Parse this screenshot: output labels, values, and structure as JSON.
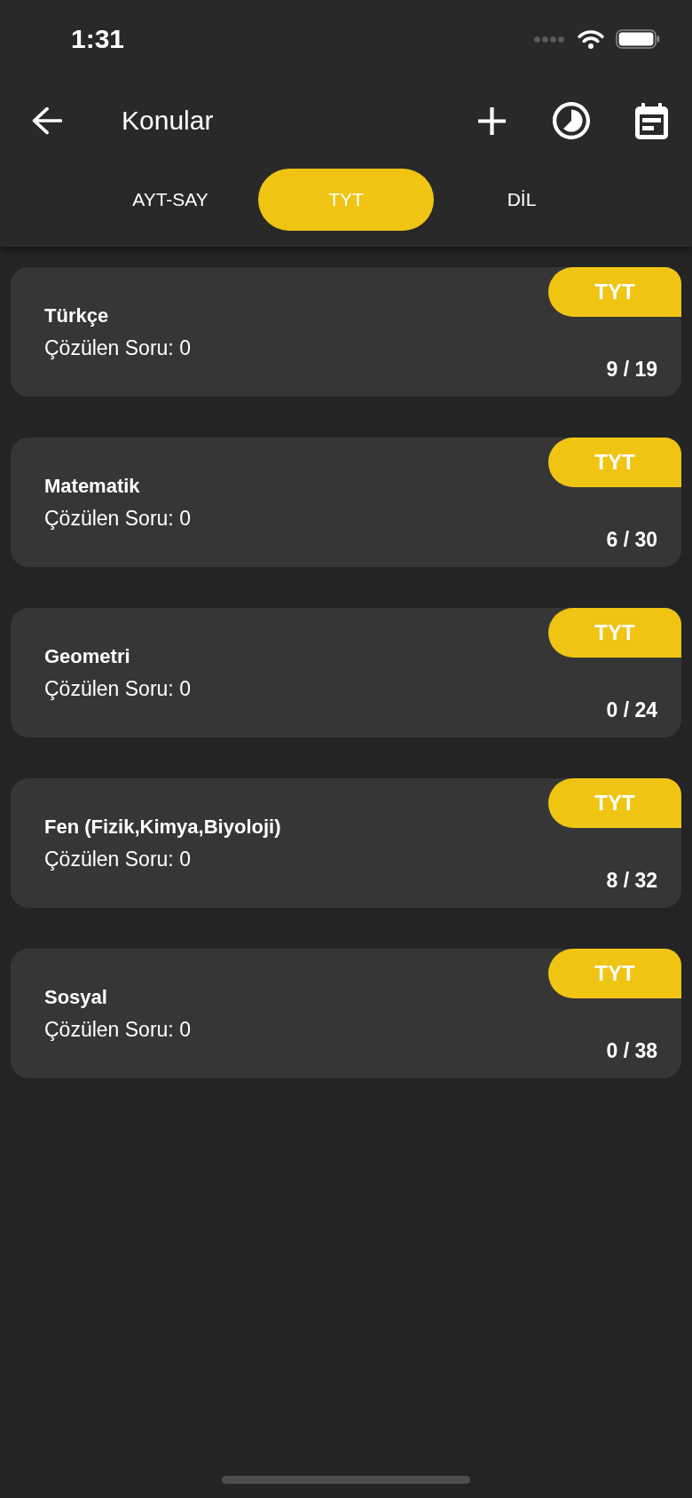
{
  "status_bar": {
    "time": "1:31"
  },
  "header": {
    "title": "Konular"
  },
  "tabs": [
    {
      "label": "AYT-SAY",
      "selected": false
    },
    {
      "label": "TYT",
      "selected": true
    },
    {
      "label": "DİL",
      "selected": false
    }
  ],
  "subjects": [
    {
      "name": "Türkçe",
      "solved": "Çözülen Soru: 0",
      "badge": "TYT",
      "progress": "9 / 19"
    },
    {
      "name": "Matematik",
      "solved": "Çözülen Soru: 0",
      "badge": "TYT",
      "progress": "6 / 30"
    },
    {
      "name": "Geometri",
      "solved": "Çözülen Soru: 0",
      "badge": "TYT",
      "progress": "0 / 24"
    },
    {
      "name": "Fen (Fizik,Kimya,Biyoloji)",
      "solved": "Çözülen Soru: 0",
      "badge": "TYT",
      "progress": "8 / 32"
    },
    {
      "name": "Sosyal",
      "solved": "Çözülen Soru: 0",
      "badge": "TYT",
      "progress": "0 / 38"
    }
  ]
}
